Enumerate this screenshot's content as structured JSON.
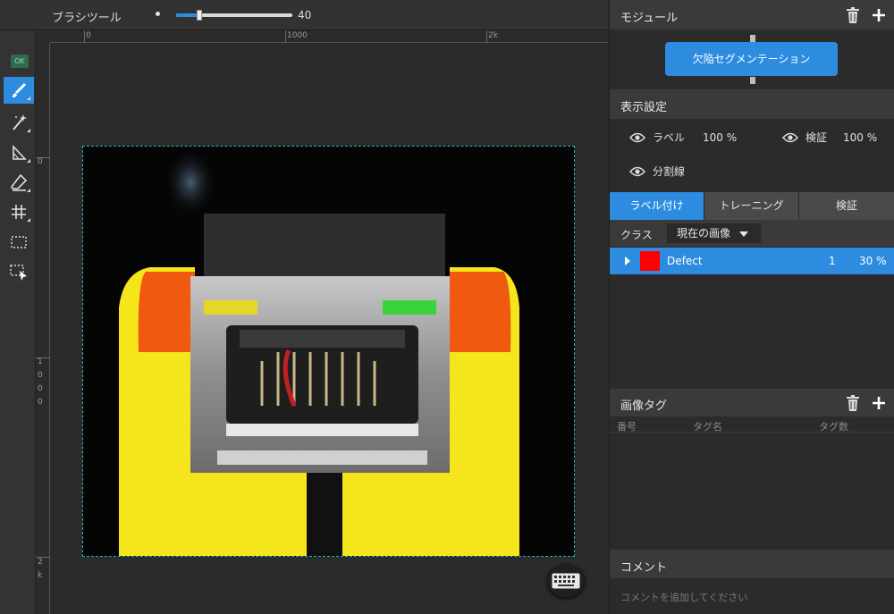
{
  "toolbar": {
    "tool_name": "ブラシツール",
    "brush_size": "40",
    "brush_size_fraction": 0.2
  },
  "leftbar": {
    "ok_badge": "OK"
  },
  "rulers": {
    "top": [
      "0",
      "1000",
      "2k"
    ],
    "left": [
      "0",
      "1",
      "0",
      "0",
      "0",
      "2",
      "k"
    ]
  },
  "module": {
    "title": "モジュール",
    "button_label": "欠陥セグメンテーション"
  },
  "display": {
    "title": "表示設定",
    "label_text": "ラベル",
    "label_opacity": "100 %",
    "verify_text": "検証",
    "verify_opacity": "100 %",
    "divider_text": "分割線"
  },
  "tabs": [
    "ラベル付け",
    "トレーニング",
    "検証"
  ],
  "class_bar": {
    "label": "クラス",
    "selected": "現在の画像"
  },
  "classes": [
    {
      "name": "Defect",
      "count": "1",
      "percent": "30 %",
      "color": "#ff0000"
    }
  ],
  "tags": {
    "title": "画像タグ",
    "columns": [
      "番号",
      "タグ名",
      "タグ数"
    ]
  },
  "comment": {
    "title": "コメント",
    "placeholder": "コメントを追加してください"
  },
  "colors": {
    "accent": "#2d8ce0",
    "panel_bg": "#2b2b2b",
    "header_bg": "#3a3a3a",
    "selection_border": "#29b4c4"
  },
  "icons": [
    "brush-icon",
    "magic-wand-icon",
    "polygon-icon",
    "eraser-icon",
    "grid-icon",
    "rect-select-icon",
    "move-select-icon",
    "trash-icon",
    "plus-icon",
    "eye-icon",
    "keyboard-icon"
  ]
}
